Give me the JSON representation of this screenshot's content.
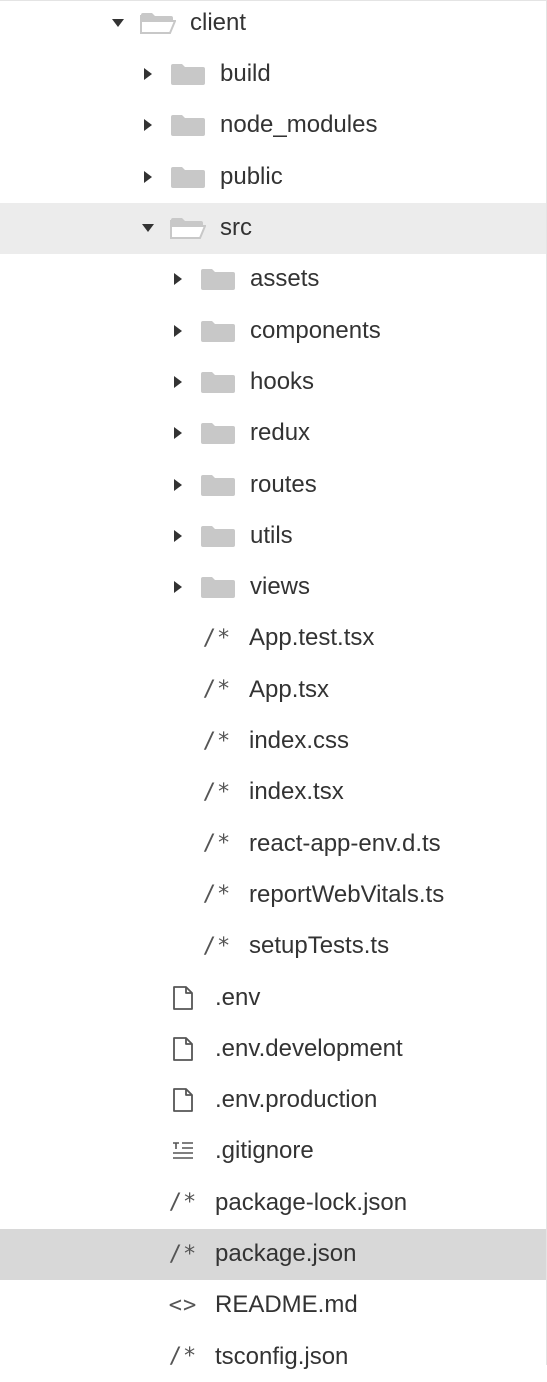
{
  "tree": {
    "items": [
      {
        "label": "client",
        "kind": "folder",
        "state": "expanded",
        "depth": 0,
        "icon": "folder-open-icon"
      },
      {
        "label": "build",
        "kind": "folder",
        "state": "collapsed",
        "depth": 1,
        "icon": "folder-icon"
      },
      {
        "label": "node_modules",
        "kind": "folder",
        "state": "collapsed",
        "depth": 1,
        "icon": "folder-icon"
      },
      {
        "label": "public",
        "kind": "folder",
        "state": "collapsed",
        "depth": 1,
        "icon": "folder-icon"
      },
      {
        "label": "src",
        "kind": "folder",
        "state": "expanded",
        "depth": 1,
        "icon": "folder-open-icon",
        "highlight": true
      },
      {
        "label": "assets",
        "kind": "folder",
        "state": "collapsed",
        "depth": 2,
        "icon": "folder-icon"
      },
      {
        "label": "components",
        "kind": "folder",
        "state": "collapsed",
        "depth": 2,
        "icon": "folder-icon"
      },
      {
        "label": "hooks",
        "kind": "folder",
        "state": "collapsed",
        "depth": 2,
        "icon": "folder-icon"
      },
      {
        "label": "redux",
        "kind": "folder",
        "state": "collapsed",
        "depth": 2,
        "icon": "folder-icon"
      },
      {
        "label": "routes",
        "kind": "folder",
        "state": "collapsed",
        "depth": 2,
        "icon": "folder-icon"
      },
      {
        "label": "utils",
        "kind": "folder",
        "state": "collapsed",
        "depth": 2,
        "icon": "folder-icon"
      },
      {
        "label": "views",
        "kind": "folder",
        "state": "collapsed",
        "depth": 2,
        "icon": "folder-icon"
      },
      {
        "label": "App.test.tsx",
        "kind": "file",
        "depth": 2,
        "icon": "comment-code-icon",
        "glyph": "/*"
      },
      {
        "label": "App.tsx",
        "kind": "file",
        "depth": 2,
        "icon": "comment-code-icon",
        "glyph": "/*"
      },
      {
        "label": "index.css",
        "kind": "file",
        "depth": 2,
        "icon": "comment-code-icon",
        "glyph": "/*"
      },
      {
        "label": "index.tsx",
        "kind": "file",
        "depth": 2,
        "icon": "comment-code-icon",
        "glyph": "/*"
      },
      {
        "label": "react-app-env.d.ts",
        "kind": "file",
        "depth": 2,
        "icon": "comment-code-icon",
        "glyph": "/*"
      },
      {
        "label": "reportWebVitals.ts",
        "kind": "file",
        "depth": 2,
        "icon": "comment-code-icon",
        "glyph": "/*"
      },
      {
        "label": "setupTests.ts",
        "kind": "file",
        "depth": 2,
        "icon": "comment-code-icon",
        "glyph": "/*"
      },
      {
        "label": ".env",
        "kind": "file",
        "depth": 1,
        "icon": "document-icon"
      },
      {
        "label": ".env.development",
        "kind": "file",
        "depth": 1,
        "icon": "document-icon"
      },
      {
        "label": ".env.production",
        "kind": "file",
        "depth": 1,
        "icon": "document-icon"
      },
      {
        "label": ".gitignore",
        "kind": "file",
        "depth": 1,
        "icon": "text-lines-icon"
      },
      {
        "label": "package-lock.json",
        "kind": "file",
        "depth": 1,
        "icon": "comment-code-icon",
        "glyph": "/*"
      },
      {
        "label": "package.json",
        "kind": "file",
        "depth": 1,
        "icon": "comment-code-icon",
        "glyph": "/*",
        "selected": true
      },
      {
        "label": "README.md",
        "kind": "file",
        "depth": 1,
        "icon": "angle-brackets-icon",
        "glyph": "<>"
      },
      {
        "label": "tsconfig.json",
        "kind": "file",
        "depth": 1,
        "icon": "comment-code-icon",
        "glyph": "/*"
      }
    ]
  },
  "colors": {
    "folder": "#c8c8c8",
    "arrow": "#333333",
    "highlight": "#ececec",
    "selected": "#d8d8d8"
  }
}
